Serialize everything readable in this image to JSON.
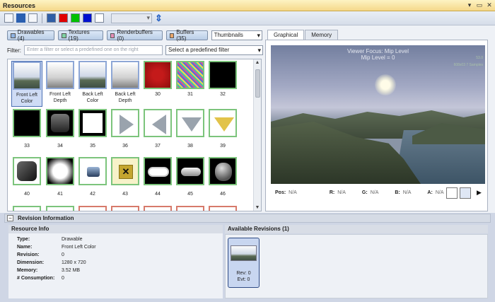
{
  "window": {
    "title": "Resources"
  },
  "toolbar": {
    "combo_value": ""
  },
  "filters": {
    "buttons": [
      {
        "label": "Drawables (4)",
        "color": "#8fb3e2"
      },
      {
        "label": "Textures (19)",
        "color": "#7fd1a3"
      },
      {
        "label": "Renderbuffers (0)",
        "color": "#e48fb8"
      },
      {
        "label": "Buffers (35)",
        "color": "#e8a66b"
      }
    ],
    "view_mode": "Thumbnails",
    "filter_label": "Filter:",
    "filter_placeholder": "Enter a filter or select a predefined one on the right",
    "predefined_filter": "Select a predefined filter"
  },
  "thumbnails": [
    {
      "label": "Front Left Color"
    },
    {
      "label": "Front Left Depth"
    },
    {
      "label": "Back Left Color"
    },
    {
      "label": "Back Left Depth"
    },
    {
      "label": "30"
    },
    {
      "label": "31"
    },
    {
      "label": "32"
    },
    {
      "label": "33"
    },
    {
      "label": "34"
    },
    {
      "label": "35"
    },
    {
      "label": "36"
    },
    {
      "label": "37"
    },
    {
      "label": "38"
    },
    {
      "label": "39"
    },
    {
      "label": "40"
    },
    {
      "label": "41"
    },
    {
      "label": "42"
    },
    {
      "label": "43"
    },
    {
      "label": "44"
    },
    {
      "label": "45"
    },
    {
      "label": "46"
    }
  ],
  "preview": {
    "tabs": [
      "Graphical",
      "Memory"
    ],
    "viewer_focus": "Viewer Focus: Mip Level",
    "mip_level": "Mip Level = 0",
    "fps": "53.0",
    "samples": "608x03 7 Samples",
    "readouts": [
      {
        "key": "Pos:",
        "value": "N/A"
      },
      {
        "key": "R:",
        "value": "N/A"
      },
      {
        "key": "G:",
        "value": "N/A"
      },
      {
        "key": "B:",
        "value": "N/A"
      },
      {
        "key": "A:",
        "value": "N/A"
      }
    ]
  },
  "revision": {
    "section_title": "Revision Information",
    "info_title": "Resource Info",
    "info": [
      {
        "key": "Type:",
        "value": "Drawable"
      },
      {
        "key": "Name:",
        "value": "Front Left Color"
      },
      {
        "key": "Revision:",
        "value": "0"
      },
      {
        "key": "Dimension:",
        "value": "1280 x 720"
      },
      {
        "key": "Memory:",
        "value": "3.52 MB"
      },
      {
        "key": "# Consumption:",
        "value": "0"
      }
    ],
    "available_title": "Available Revisions (1)",
    "revisions": [
      {
        "rev": "Rev: 0",
        "evt": "Evt: 0"
      }
    ]
  }
}
